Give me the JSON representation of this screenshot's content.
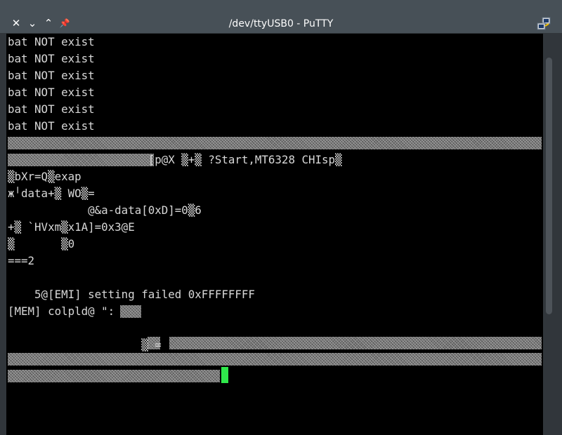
{
  "window": {
    "title": "/dev/ttyUSB0 - PuTTY",
    "buttons": {
      "close": "✕",
      "minimize": "⌄",
      "maximize": "⌃",
      "pin": "📌"
    }
  },
  "terminal": {
    "lines": [
      "bat NOT exist",
      "bat NOT exist",
      "bat NOT exist",
      "bat NOT exist",
      "bat NOT exist",
      "bat NOT exist",
      "",
      "                     [p@X ▒+▒ ?Start,MT6328 CHIsp▒",
      "▒bXr=Q▒exap",
      "ж╵data+▒ WO▒=",
      "            @&a-data[0xD]=0▒6",
      "+▒ `HVxm▒x1A]=0x3@E",
      "▒       ▒0",
      "===2",
      "",
      "    5@[EMI] setting failed 0xFFFFFFFF",
      "[MEM] colpld@ \":",
      "",
      "                    ▒ =",
      "",
      ""
    ],
    "cursor_color": "#2fe84b",
    "background": "#000000",
    "foreground": "#d8d8d8"
  }
}
